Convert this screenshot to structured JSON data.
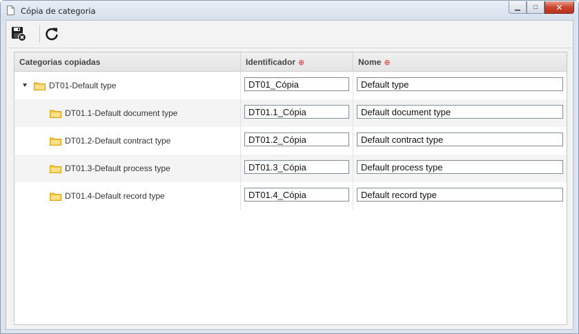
{
  "window": {
    "title": "Cópia de categoria",
    "controls": {
      "minimize": "▁",
      "maximize": "□",
      "close": "✕"
    }
  },
  "toolbar": {
    "buttons": [
      {
        "name": "save-close",
        "icon": "floppy-disk-close-icon"
      },
      {
        "name": "refresh",
        "icon": "refresh-icon"
      }
    ]
  },
  "grid": {
    "columns": {
      "category": "Categorias copiadas",
      "identifier": "Identificador",
      "name": "Nome",
      "required_marker": "⊕"
    },
    "rows": [
      {
        "label": "DT01-Default type",
        "identifier": "DT01_Cópia",
        "name": "Default type",
        "expanded": true,
        "level": 0
      },
      {
        "label": "DT01.1-Default document type",
        "identifier": "DT01.1_Cópia",
        "name": "Default document type",
        "level": 1
      },
      {
        "label": "DT01.2-Default contract type",
        "identifier": "DT01.2_Cópia",
        "name": "Default contract type",
        "level": 1
      },
      {
        "label": "DT01.3-Default process type",
        "identifier": "DT01.3_Cópia",
        "name": "Default process type",
        "level": 1
      },
      {
        "label": "DT01.4-Default record type",
        "identifier": "DT01.4_Cópia",
        "name": "Default record type",
        "level": 1
      }
    ]
  },
  "colors": {
    "folder": "#f5c533",
    "required": "#d9342b",
    "close_button": "#c9452e"
  }
}
